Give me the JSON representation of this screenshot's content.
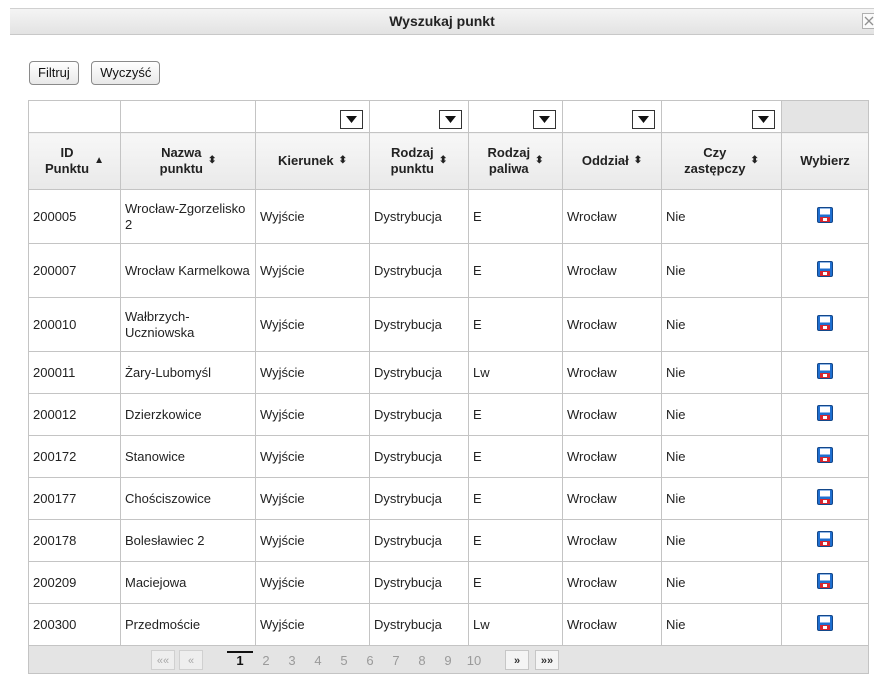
{
  "dialog": {
    "title": "Wyszukaj punkt"
  },
  "toolbar": {
    "filter_label": "Filtruj",
    "clear_label": "Wyczyść"
  },
  "table": {
    "headers": {
      "id": [
        "ID",
        "Punktu"
      ],
      "name": [
        "Nazwa",
        "punktu"
      ],
      "direction": [
        "Kierunek"
      ],
      "point_type": [
        "Rodzaj",
        "punktu"
      ],
      "fuel_type": [
        "Rodzaj",
        "paliwa"
      ],
      "branch": [
        "Oddział"
      ],
      "substitute": [
        "Czy",
        "zastępczy"
      ],
      "select": [
        "Wybierz"
      ]
    },
    "sort_icons": {
      "asc": "▲",
      "both": "⬍"
    },
    "rows": [
      {
        "id": "200005",
        "name": "Wrocław-Zgorzelisko 2",
        "direction": "Wyjście",
        "point_type": "Dystrybucja",
        "fuel_type": "E",
        "branch": "Wrocław",
        "substitute": "Nie"
      },
      {
        "id": "200007",
        "name": "Wrocław Karmelkowa",
        "direction": "Wyjście",
        "point_type": "Dystrybucja",
        "fuel_type": "E",
        "branch": "Wrocław",
        "substitute": "Nie"
      },
      {
        "id": "200010",
        "name": "Wałbrzych-Uczniowska",
        "direction": "Wyjście",
        "point_type": "Dystrybucja",
        "fuel_type": "E",
        "branch": "Wrocław",
        "substitute": "Nie"
      },
      {
        "id": "200011",
        "name": "Żary-Lubomyśl",
        "direction": "Wyjście",
        "point_type": "Dystrybucja",
        "fuel_type": "Lw",
        "branch": "Wrocław",
        "substitute": "Nie"
      },
      {
        "id": "200012",
        "name": "Dzierzkowice",
        "direction": "Wyjście",
        "point_type": "Dystrybucja",
        "fuel_type": "E",
        "branch": "Wrocław",
        "substitute": "Nie"
      },
      {
        "id": "200172",
        "name": "Stanowice",
        "direction": "Wyjście",
        "point_type": "Dystrybucja",
        "fuel_type": "E",
        "branch": "Wrocław",
        "substitute": "Nie"
      },
      {
        "id": "200177",
        "name": "Chościszowice",
        "direction": "Wyjście",
        "point_type": "Dystrybucja",
        "fuel_type": "E",
        "branch": "Wrocław",
        "substitute": "Nie"
      },
      {
        "id": "200178",
        "name": "Bolesławiec 2",
        "direction": "Wyjście",
        "point_type": "Dystrybucja",
        "fuel_type": "E",
        "branch": "Wrocław",
        "substitute": "Nie"
      },
      {
        "id": "200209",
        "name": "Maciejowa",
        "direction": "Wyjście",
        "point_type": "Dystrybucja",
        "fuel_type": "E",
        "branch": "Wrocław",
        "substitute": "Nie"
      },
      {
        "id": "200300",
        "name": "Przedmoście",
        "direction": "Wyjście",
        "point_type": "Dystrybucja",
        "fuel_type": "Lw",
        "branch": "Wrocław",
        "substitute": "Nie"
      }
    ]
  },
  "pager": {
    "first": "««",
    "prev": "«",
    "next": "»",
    "last": "»»",
    "pages": [
      "1",
      "2",
      "3",
      "4",
      "5",
      "6",
      "7",
      "8",
      "9",
      "10"
    ],
    "current": "1"
  },
  "icons": {
    "close": "close-icon",
    "save": "save-icon",
    "dropdown": "chevron-down-icon"
  },
  "colors": {
    "save_blue": "#1f6fd0",
    "save_red": "#d8262e"
  }
}
